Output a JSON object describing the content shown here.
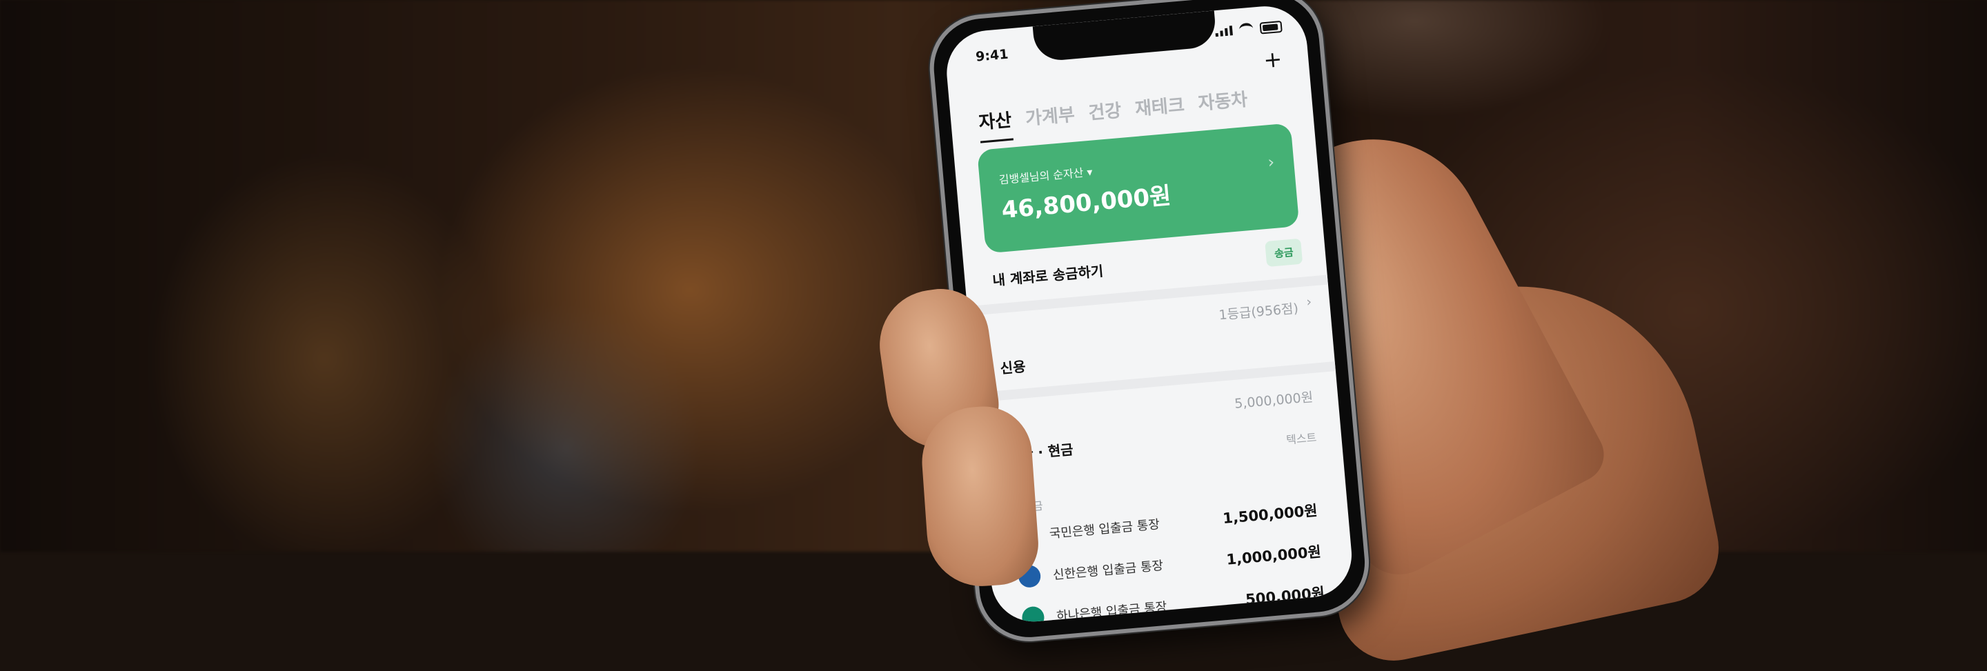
{
  "status": {
    "time": "9:41"
  },
  "tabs": [
    "자산",
    "가계부",
    "건강",
    "재테크",
    "자동차"
  ],
  "net_worth": {
    "label": "김뱅셀님의 순자산 ▾",
    "amount": "46,800,000원"
  },
  "send_button": "송금",
  "transfer_row": "내 계좌로 송금하기",
  "credit": {
    "grade": "1등급(956점)",
    "title": "신용"
  },
  "accounts_section": {
    "total": "5,000,000원",
    "title": "계좌 · 현금",
    "tag": "텍스트",
    "subheader": "입출금"
  },
  "accounts": [
    {
      "name": "국민은행 입출금 통장",
      "amount": "1,500,000원",
      "logo_color": "#f2b01e"
    },
    {
      "name": "신한은행 입출금 통장",
      "amount": "1,000,000원",
      "logo_color": "#1f5fa8"
    },
    {
      "name": "하나은행 입출금 통장",
      "amount": "500,000원",
      "logo_color": "#0f8a6d"
    }
  ],
  "accent_color": "#45b175"
}
